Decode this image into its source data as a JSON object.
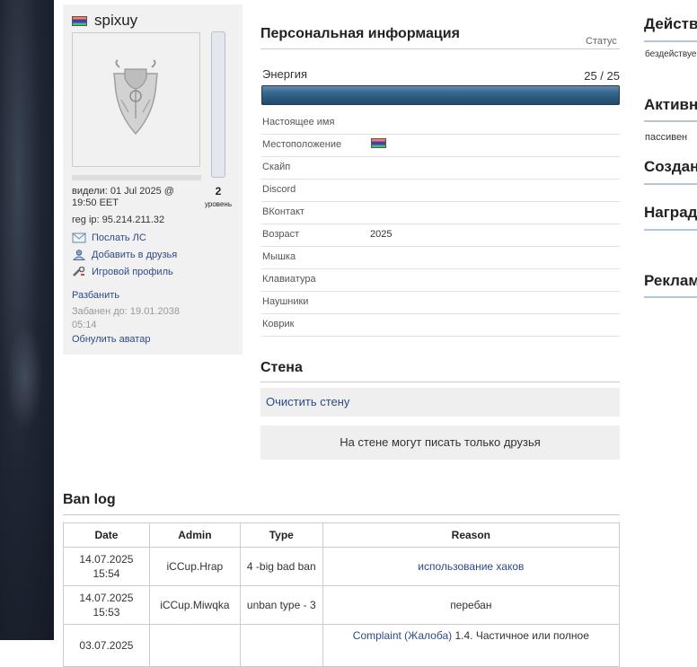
{
  "profile": {
    "username": "spixuy",
    "level": "2",
    "level_label": "уровень",
    "last_seen": "видели: 01 Jul 2025 @ 19:50 EET",
    "reg_ip": "reg ip: 95.214.211.32",
    "actions": [
      "Послать ЛС",
      "Добавить в друзья",
      "Игровой профиль"
    ],
    "ban_link": "Разбанить",
    "banned_until": "Забанен до: 19.01.2038 05:14",
    "reset_avatar": "Обнулить аватар"
  },
  "personal": {
    "title": "Персональная информация",
    "status_label": "Статус",
    "energy_label": "Энергия",
    "energy_value": "25 / 25",
    "energy_fraction": 1.0,
    "rows": [
      {
        "label": "Настоящее имя",
        "value": ""
      },
      {
        "label": "Местоположение",
        "value": ""
      },
      {
        "label": "Скайп",
        "value": ""
      },
      {
        "label": "Discord",
        "value": ""
      },
      {
        "label": "ВКонтакт",
        "value": ""
      },
      {
        "label": "Возраст",
        "value": "2025"
      },
      {
        "label": "Мышка",
        "value": ""
      },
      {
        "label": "Клавиатура",
        "value": ""
      },
      {
        "label": "Наушники",
        "value": ""
      },
      {
        "label": "Коврик",
        "value": ""
      }
    ]
  },
  "wall": {
    "title": "Стена",
    "clear_label": "Очистить стену",
    "note": "На стене могут писать только друзья"
  },
  "banlog": {
    "title": "Ban log",
    "headers": [
      "Date",
      "Admin",
      "Type",
      "Reason"
    ],
    "rows": [
      {
        "date": "14.07.2025 15:54",
        "admin": "iCCup.Hrap",
        "type": "4 -big bad ban",
        "reason": "использование хаков",
        "reason_link": true
      },
      {
        "date": "14.07.2025 15:53",
        "admin": "iCCup.Miwqka",
        "type": "unban type - 3",
        "reason": "перебан",
        "reason_link": false
      },
      {
        "date": "03.07.2025",
        "admin": "",
        "type": "",
        "reason_link_text": "Complaint (Жалоба)",
        "reason": "1.4. Частичное или полное",
        "reason_link": true
      }
    ]
  },
  "right": {
    "sections": [
      "Действ",
      "Активн",
      "Создан",
      "Наград",
      "Реклам"
    ],
    "texts": [
      "бездействуе",
      "пассивен"
    ]
  },
  "colors": {
    "link": "#2c4a8a",
    "energy": "#2a587c",
    "accent_line": "#b3c6da"
  }
}
